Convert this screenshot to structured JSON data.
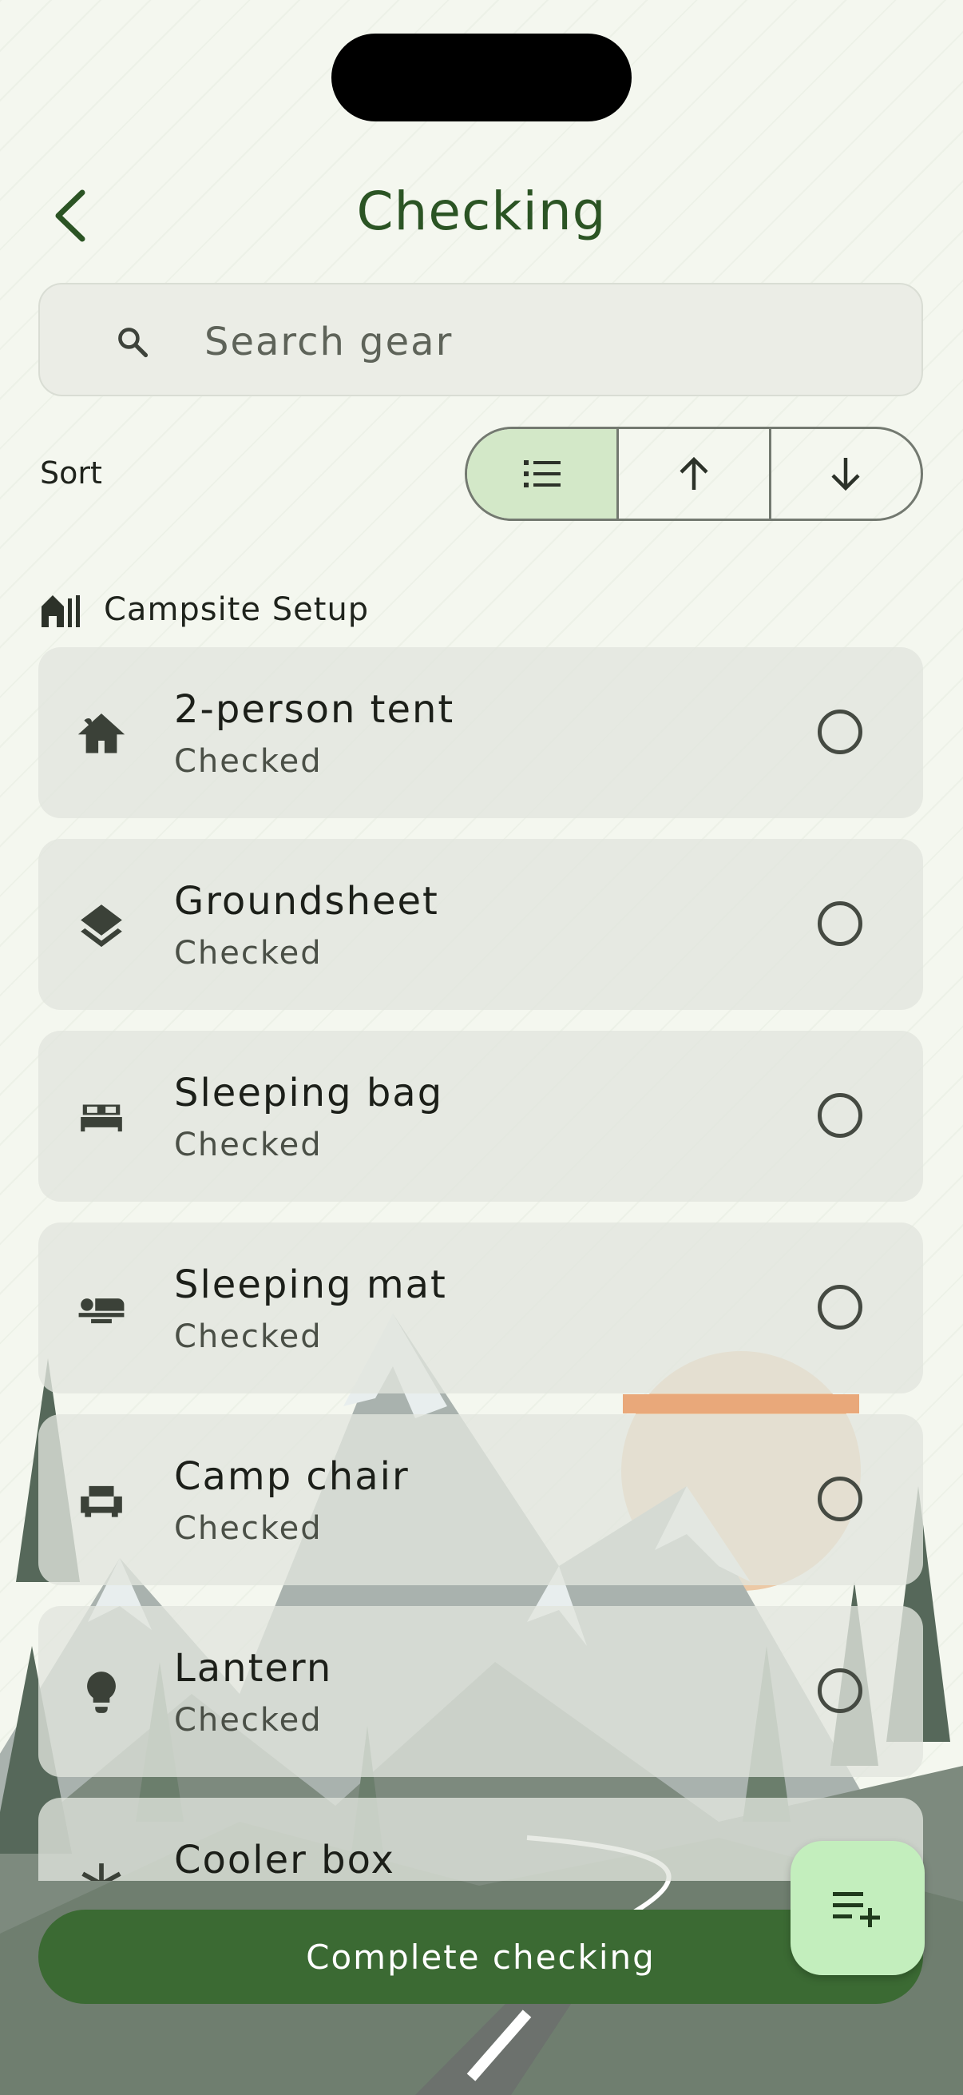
{
  "header": {
    "title": "Checking"
  },
  "search": {
    "placeholder": "Search gear"
  },
  "sort": {
    "label": "Sort",
    "options": [
      "list-icon",
      "arrow-up-icon",
      "arrow-down-icon"
    ],
    "selected": 0
  },
  "section": {
    "title": "Campsite Setup",
    "icon": "cabin-icon"
  },
  "items": [
    {
      "name": "2-person tent",
      "status": "Checked",
      "icon": "cabin-icon",
      "checked": false
    },
    {
      "name": "Groundsheet",
      "status": "Checked",
      "icon": "layers-icon",
      "checked": false
    },
    {
      "name": "Sleeping bag",
      "status": "Checked",
      "icon": "bed-icon",
      "checked": false
    },
    {
      "name": "Sleeping mat",
      "status": "Checked",
      "icon": "mat-icon",
      "checked": false
    },
    {
      "name": "Camp chair",
      "status": "Checked",
      "icon": "chair-icon",
      "checked": false
    },
    {
      "name": "Lantern",
      "status": "Checked",
      "icon": "lightbulb-icon",
      "checked": false
    },
    {
      "name": "Cooler box",
      "status": "",
      "icon": "snowflake-icon",
      "checked": false
    }
  ],
  "actions": {
    "complete_label": "Complete checking",
    "fab_icon": "playlist-add-icon"
  },
  "colors": {
    "accent": "#3b6a33",
    "title": "#2b5424",
    "fab": "#c3eebd",
    "segment_selected": "#d3e8c8",
    "background": "#f4f7ef"
  }
}
